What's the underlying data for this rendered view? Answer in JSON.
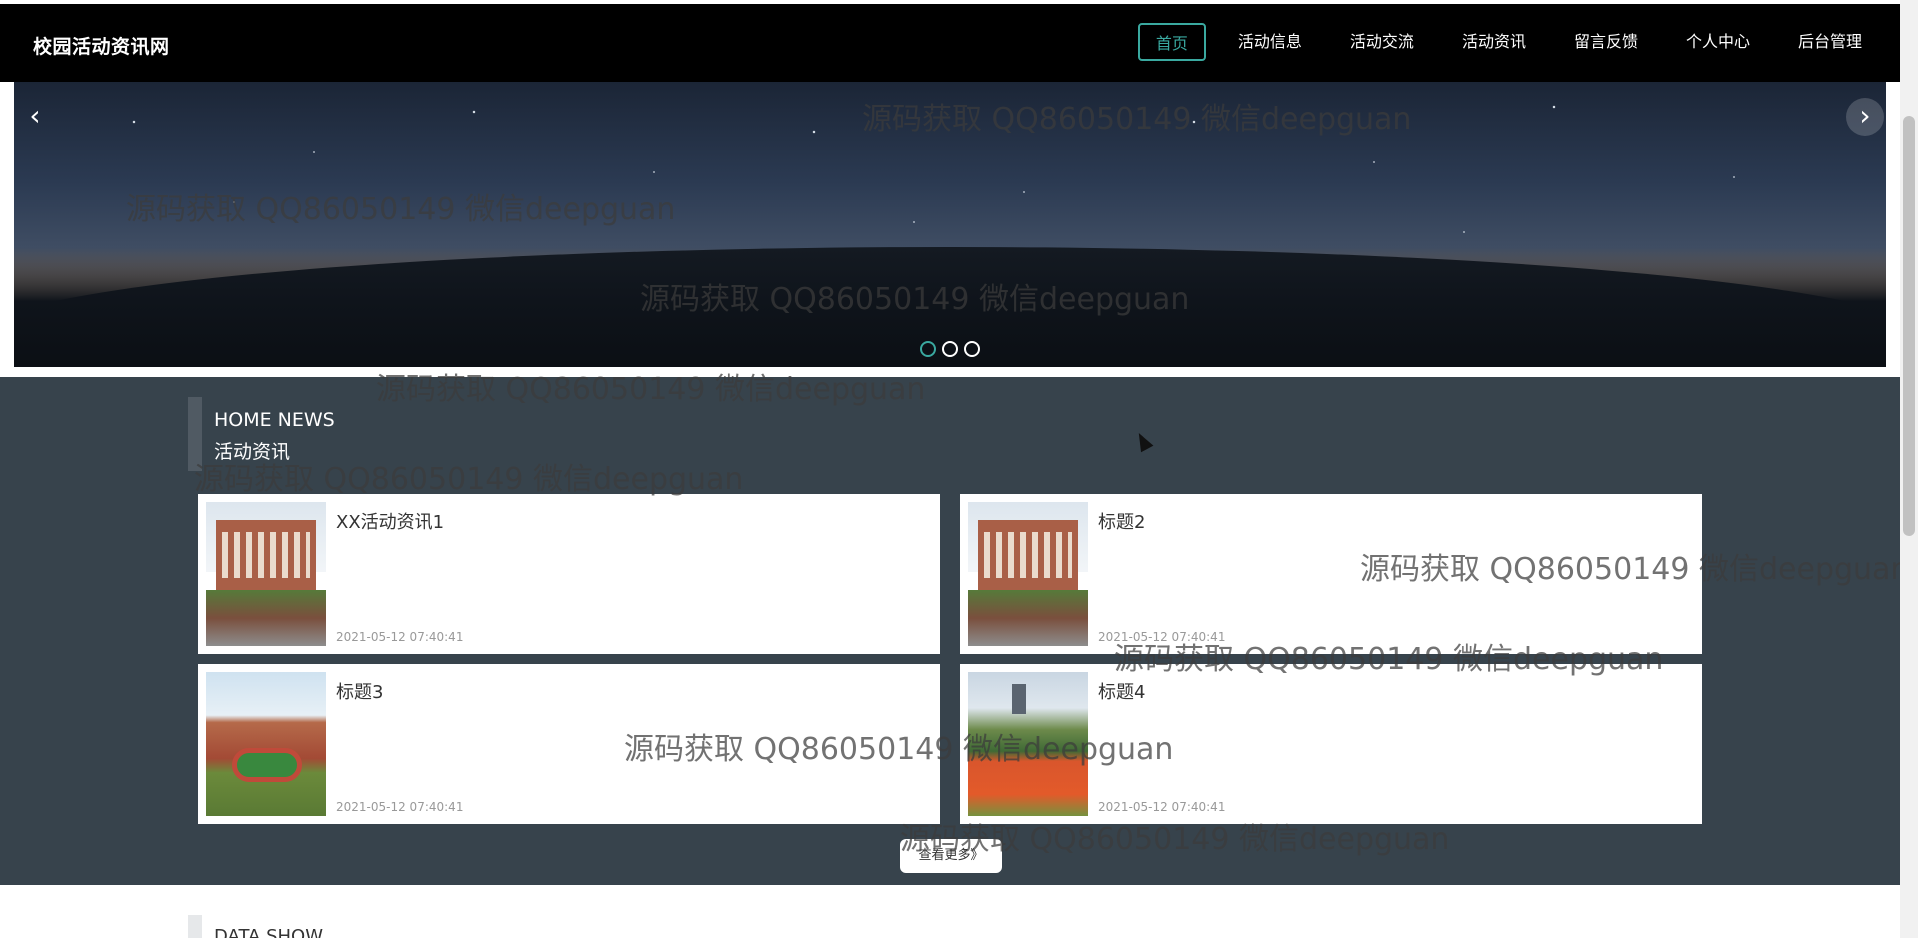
{
  "site": {
    "title": "校园活动资讯网"
  },
  "nav": {
    "items": [
      {
        "label": "首页",
        "active": true
      },
      {
        "label": "活动信息",
        "active": false
      },
      {
        "label": "活动交流",
        "active": false
      },
      {
        "label": "活动资讯",
        "active": false
      },
      {
        "label": "留言反馈",
        "active": false
      },
      {
        "label": "个人中心",
        "active": false
      },
      {
        "label": "后台管理",
        "active": false
      }
    ]
  },
  "banner": {
    "prev_icon": "chevron-left-icon",
    "next_icon": "chevron-right-icon",
    "dot_count": 3,
    "active_dot": 0
  },
  "news": {
    "heading_en": "HOME NEWS",
    "heading_cn": "活动资讯",
    "items": [
      {
        "title": "XX活动资讯1",
        "date": "2021-05-12 07:40:41"
      },
      {
        "title": "标题2",
        "date": "2021-05-12 07:40:41"
      },
      {
        "title": "标题3",
        "date": "2021-05-12 07:40:41"
      },
      {
        "title": "标题4",
        "date": "2021-05-12 07:40:41"
      }
    ],
    "more_label": "查看更多》"
  },
  "data_show": {
    "heading_en": "DATA SHOW"
  },
  "watermark": "源码获取 QQ86050149 微信deepguan",
  "colors": {
    "accent": "#3aa9a0",
    "topbar": "#000000",
    "news_bg": "#37434c"
  }
}
